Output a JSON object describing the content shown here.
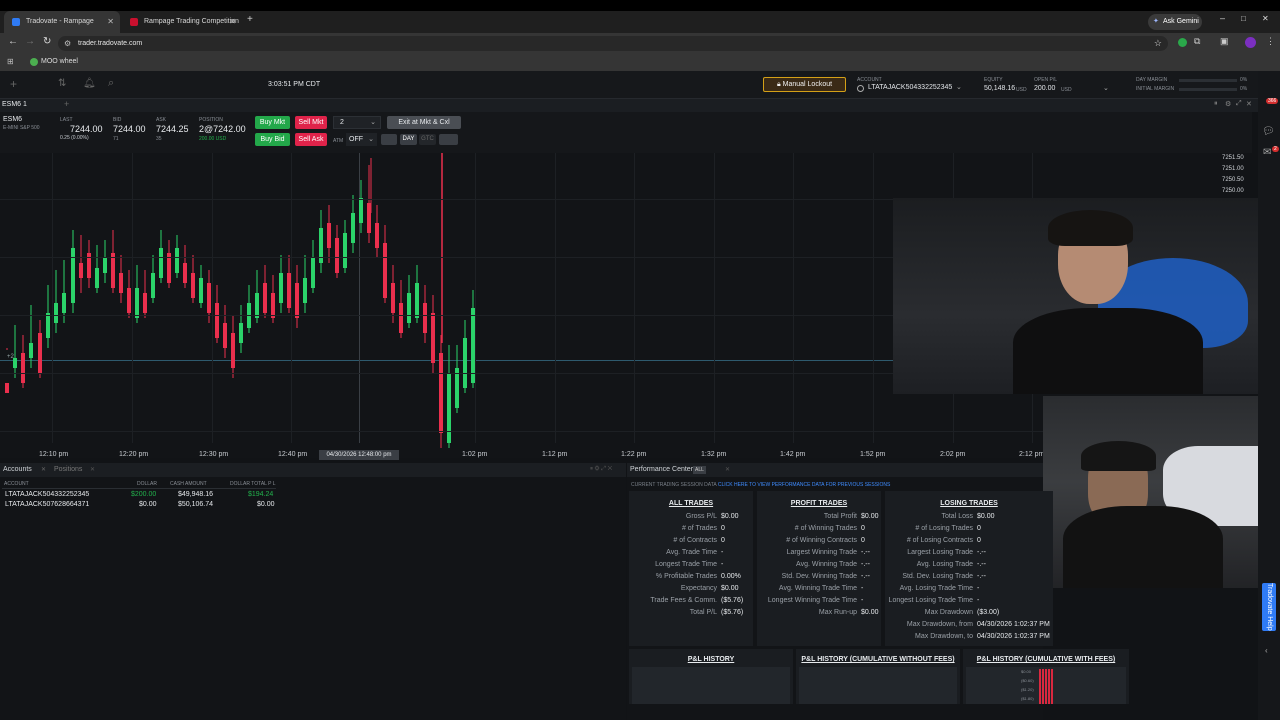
{
  "browser": {
    "tabs": [
      {
        "label": "Tradovate - Rampage",
        "active": true
      },
      {
        "label": "Rampage Trading Competition",
        "active": false
      }
    ],
    "ask_gemini": "Ask Gemini",
    "url": "trader.tradovate.com",
    "bookmark": "MOO wheel"
  },
  "topbar": {
    "time": "3:03:51 PM CDT",
    "manual_lockout": "Manual Lockout",
    "account_label": "ACCOUNT",
    "account_value": "LTATAJACK504332252345",
    "equity_label": "EQUITY",
    "equity_value": "50,148.16",
    "equity_unit": "USD",
    "open_pl_label": "OPEN P/L",
    "open_pl_value": "200.00",
    "open_pl_unit": "USD",
    "day_margin_label": "DAY MARGIN",
    "initial_margin_label": "INITIAL MARGIN",
    "day_margin_pct": "0%",
    "initial_margin_pct": "0%"
  },
  "chart_tab": {
    "label": "ESM6 1"
  },
  "quote": {
    "symbol": "ESM6",
    "desc": "E-MINI S&P 500",
    "last_label": "LAST",
    "last": "7244.00",
    "change": "0.25 (0.00%)",
    "bid_label": "BID",
    "bid": "7244.00",
    "bid_size": "71",
    "ask_label": "ASK",
    "ask": "7244.25",
    "ask_size": "35",
    "position_label": "POSITION",
    "position": "2@7242.00",
    "position_pl": "200.00 USD"
  },
  "order": {
    "buy_mkt": "Buy Mkt",
    "sell_mkt": "Sell Mkt",
    "buy_bid": "Buy Bid",
    "sell_ask": "Sell Ask",
    "qty": "2",
    "exit": "Exit at Mkt & Cxl",
    "atm_label": "ATM",
    "atm_value": "OFF",
    "tif_day": "DAY",
    "tif_gtc": "GTC"
  },
  "chart_data": {
    "type": "candlestick",
    "y_ticks": [
      "7251.50",
      "7251.00",
      "7250.50",
      "7250.00"
    ],
    "x_ticks": [
      "12:10 pm",
      "12:20 pm",
      "12:30 pm",
      "12:40 pm",
      "1:02 pm",
      "1:12 pm",
      "1:22 pm",
      "1:32 pm",
      "1:42 pm",
      "1:52 pm",
      "2:02 pm",
      "2:12 pm"
    ],
    "crosshair_x_label": "04/30/2026 12:48:00 pm",
    "position_marker": "+2"
  },
  "accounts_panel": {
    "tabs": [
      "Accounts",
      "Positions"
    ],
    "headers": [
      "ACCOUNT",
      "DOLLAR",
      "CASH AMOUNT",
      "DOLLAR TOTAL P L"
    ],
    "rows": [
      {
        "account": "LTATAJACK504332252345",
        "dollar": "$200.00",
        "cash": "$49,948.16",
        "total": "$194.24"
      },
      {
        "account": "LTATAJACK507628664371",
        "dollar": "$0.00",
        "cash": "$50,106.74",
        "total": "$0.00"
      }
    ]
  },
  "performance": {
    "title": "Performance Center",
    "badge": "ALL",
    "notice_prefix": "CURRENT TRADING SESSION DATA",
    "notice_link": "CLICK HERE TO VIEW PERFORMANCE DATA FOR PREVIOUS SESSIONS",
    "all_trades": {
      "title": "ALL TRADES",
      "rows": [
        [
          "Gross P/L",
          "$0.00"
        ],
        [
          "# of Trades",
          "0"
        ],
        [
          "# of Contracts",
          "0"
        ],
        [
          "Avg. Trade Time",
          "-"
        ],
        [
          "Longest Trade Time",
          "-"
        ],
        [
          "% Profitable Trades",
          "0.00%"
        ],
        [
          "Expectancy",
          "$0.00"
        ],
        [
          "Trade Fees & Comm.",
          "($5.76)"
        ],
        [
          "Total P/L",
          "($5.76)"
        ]
      ]
    },
    "profit_trades": {
      "title": "PROFIT TRADES",
      "rows": [
        [
          "Total Profit",
          "$0.00"
        ],
        [
          "# of Winning Trades",
          "0"
        ],
        [
          "# of Winning Contracts",
          "0"
        ],
        [
          "Largest Winning Trade",
          "-.--"
        ],
        [
          "Avg. Winning Trade",
          "-.--"
        ],
        [
          "Std. Dev. Winning Trade",
          "-.--"
        ],
        [
          "Avg. Winning Trade Time",
          "-"
        ],
        [
          "Longest Winning Trade Time",
          "-"
        ],
        [
          "Max Run-up",
          "$0.00"
        ]
      ]
    },
    "losing_trades": {
      "title": "LOSING TRADES",
      "rows": [
        [
          "Total Loss",
          "$0.00"
        ],
        [
          "# of Losing Trades",
          "0"
        ],
        [
          "# of Losing Contracts",
          "0"
        ],
        [
          "Largest Losing Trade",
          "-.--"
        ],
        [
          "Avg. Losing Trade",
          "-.--"
        ],
        [
          "Std. Dev. Losing Trade",
          "-.--"
        ],
        [
          "Avg. Losing Trade Time",
          "-"
        ],
        [
          "Longest Losing Trade Time",
          "-"
        ],
        [
          "Max Drawdown",
          "($3.00)"
        ],
        [
          "Max Drawdown, from",
          "04/30/2026 1:02:37 PM"
        ],
        [
          "Max Drawdown, to",
          "04/30/2026 1:02:37 PM"
        ]
      ]
    },
    "history": [
      "P&L HISTORY",
      "P&L HISTORY (CUMULATIVE WITHOUT FEES)",
      "P&L HISTORY (CUMULATIVE WITH FEES)"
    ],
    "history_axis": [
      "$0.00",
      "($0.60)",
      "($1.20)",
      "($1.80)"
    ]
  },
  "side": {
    "badge_top": "366",
    "badge_mid": "2",
    "help": "Tradovate Help"
  }
}
